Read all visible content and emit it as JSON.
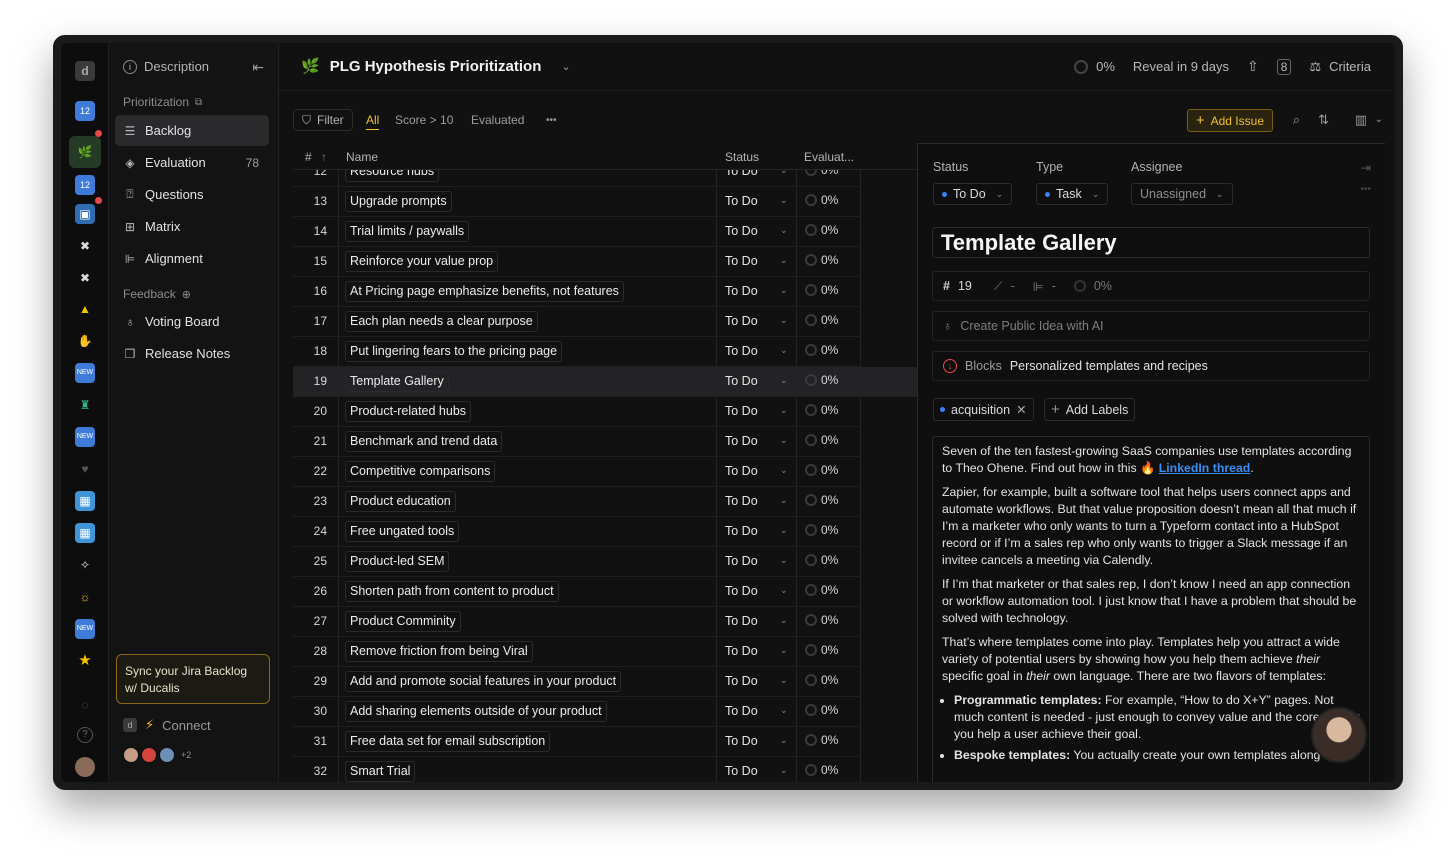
{
  "header": {
    "title": "PLG Hypothesis Prioritization",
    "progress": "0%",
    "reveal": "Reveal in 9 days",
    "criteria": "Criteria"
  },
  "sidebar": {
    "description": "Description",
    "prioritization_section": "Prioritization",
    "items": [
      {
        "label": "Backlog"
      },
      {
        "label": "Evaluation",
        "count": "78"
      },
      {
        "label": "Questions"
      },
      {
        "label": "Matrix"
      },
      {
        "label": "Alignment"
      }
    ],
    "feedback_section": "Feedback",
    "feedback_items": [
      {
        "label": "Voting Board"
      },
      {
        "label": "Release Notes"
      }
    ],
    "sync_box": "Sync your Jira Backlog w/ Ducalis",
    "connect": "Connect",
    "avatar_more": "+2"
  },
  "filterbar": {
    "filter": "Filter",
    "tabs": [
      "All",
      "Score > 10",
      "Evaluated"
    ],
    "more": "•••",
    "add_issue": "Add Issue"
  },
  "table": {
    "columns": [
      "#",
      "Name",
      "Status",
      "Evaluat..."
    ],
    "rows": [
      {
        "num": "12",
        "name": "Resource hubs",
        "status": "To Do",
        "eval": "0%"
      },
      {
        "num": "13",
        "name": "Upgrade prompts",
        "status": "To Do",
        "eval": "0%"
      },
      {
        "num": "14",
        "name": "Trial limits / paywalls",
        "status": "To Do",
        "eval": "0%"
      },
      {
        "num": "15",
        "name": "Reinforce your value prop",
        "status": "To Do",
        "eval": "0%"
      },
      {
        "num": "16",
        "name": "At Pricing page emphasize benefits, not features",
        "status": "To Do",
        "eval": "0%"
      },
      {
        "num": "17",
        "name": "Each plan needs a clear purpose",
        "status": "To Do",
        "eval": "0%"
      },
      {
        "num": "18",
        "name": "Put lingering fears to the pricing page",
        "status": "To Do",
        "eval": "0%"
      },
      {
        "num": "19",
        "name": "Template Gallery",
        "status": "To Do",
        "eval": "0%"
      },
      {
        "num": "20",
        "name": "Product-related hubs",
        "status": "To Do",
        "eval": "0%"
      },
      {
        "num": "21",
        "name": "Benchmark and trend data",
        "status": "To Do",
        "eval": "0%"
      },
      {
        "num": "22",
        "name": "Competitive comparisons",
        "status": "To Do",
        "eval": "0%"
      },
      {
        "num": "23",
        "name": "Product education",
        "status": "To Do",
        "eval": "0%"
      },
      {
        "num": "24",
        "name": "Free ungated tools",
        "status": "To Do",
        "eval": "0%"
      },
      {
        "num": "25",
        "name": "Product-led SEM",
        "status": "To Do",
        "eval": "0%"
      },
      {
        "num": "26",
        "name": "Shorten path from content to product",
        "status": "To Do",
        "eval": "0%"
      },
      {
        "num": "27",
        "name": "Product Comminity",
        "status": "To Do",
        "eval": "0%"
      },
      {
        "num": "28",
        "name": "Remove friction from being Viral",
        "status": "To Do",
        "eval": "0%"
      },
      {
        "num": "29",
        "name": "Add and promote social features in your product",
        "status": "To Do",
        "eval": "0%"
      },
      {
        "num": "30",
        "name": "Add sharing elements outside of your product",
        "status": "To Do",
        "eval": "0%"
      },
      {
        "num": "31",
        "name": "Free data set for email subscription",
        "status": "To Do",
        "eval": "0%"
      },
      {
        "num": "32",
        "name": "Smart Trial",
        "status": "To Do",
        "eval": "0%"
      }
    ]
  },
  "detail": {
    "status_label": "Status",
    "type_label": "Type",
    "assignee_label": "Assignee",
    "status_value": "To Do",
    "type_value": "Task",
    "assignee_value": "Unassigned",
    "title": "Template Gallery",
    "id": "19",
    "metric_a": "-",
    "metric_b": "-",
    "progress": "0%",
    "ai_placeholder": "Create Public Idea with AI",
    "blocks_label": "Blocks",
    "blocks_value": "Personalized templates and recipes",
    "label": "acquisition",
    "add_labels": "Add Labels",
    "desc_p1_a": "Seven of the ten fastest-growing SaaS companies use templates according to Theo Ohene. Find out how in this 🔥 ",
    "desc_p1_link": "LinkedIn thread",
    "desc_p1_b": ".",
    "desc_p2": "Zapier, for example, built a software tool that helps users connect apps and automate workflows. But that value proposition doesn’t mean all that much if I’m a marketer who only wants to turn a Typeform contact into a HubSpot record or if I’m a sales rep who only wants to trigger a Slack message if an invitee cancels a meeting via Calendly.",
    "desc_p3": "If I’m that marketer or that sales rep, I don’t know I need an app connection or workflow automation tool. I just know that I have a problem that should be solved with technology.",
    "desc_p4_a": "That’s where templates come into play. Templates help you attract a wide variety of potential users by showing how you help them achieve ",
    "desc_p4_em1": "their",
    "desc_p4_b": " specific goal in ",
    "desc_p4_em2": "their",
    "desc_p4_c": " own language. There are two flavors of templates:",
    "bullet1_bold": "Programmatic templates:",
    "bullet1_text": " For example, “How to do X+Y” pages. Not much content is needed - just enough to convey value and the core of how you help a user achieve their goal.",
    "bullet2_bold": "Bespoke templates:",
    "bullet2_text": " You actually create your own templates along"
  },
  "colors": {
    "accent": "#f0c036",
    "link": "#3b8cf0",
    "background": "#111112",
    "notification": "#e5484d"
  }
}
